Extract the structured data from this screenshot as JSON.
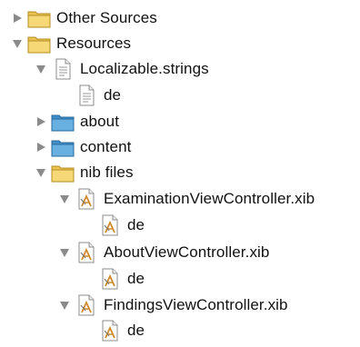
{
  "tree": {
    "rows": [
      {
        "label": "Other Sources",
        "icon": "folder-icon",
        "expanded": false
      },
      {
        "label": "Resources",
        "icon": "folder-icon",
        "expanded": true
      },
      {
        "label": "Localizable.strings",
        "icon": "strings-file-icon",
        "expanded": true
      },
      {
        "label": "de",
        "icon": "strings-file-icon",
        "expanded": null
      },
      {
        "label": "about",
        "icon": "blue-folder-icon",
        "expanded": false
      },
      {
        "label": "content",
        "icon": "blue-folder-icon",
        "expanded": false
      },
      {
        "label": "nib files",
        "icon": "folder-icon",
        "expanded": true
      },
      {
        "label": "ExaminationViewController.xib",
        "icon": "xib-file-icon",
        "expanded": true
      },
      {
        "label": "de",
        "icon": "xib-file-icon",
        "expanded": null
      },
      {
        "label": "AboutViewController.xib",
        "icon": "xib-file-icon",
        "expanded": true
      },
      {
        "label": "de",
        "icon": "xib-file-icon",
        "expanded": null
      },
      {
        "label": "FindingsViewController.xib",
        "icon": "xib-file-icon",
        "expanded": true
      },
      {
        "label": "de",
        "icon": "xib-file-icon",
        "expanded": null
      }
    ]
  },
  "colors": {
    "folder_yellow": "#f3d26a",
    "folder_blue": "#5aa6d8",
    "disclosure": "#8a8a8a",
    "text": "#111111"
  }
}
